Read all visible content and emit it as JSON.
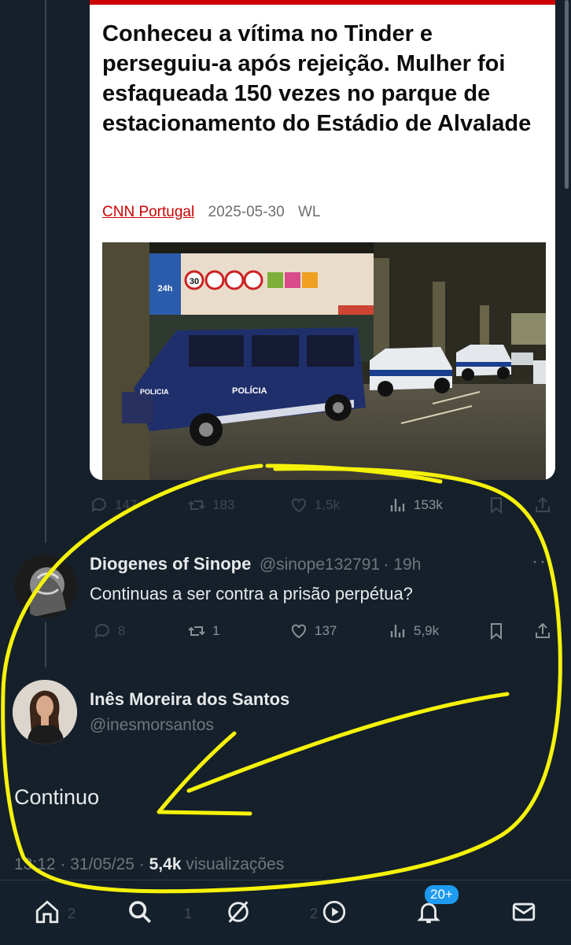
{
  "article": {
    "headline": "Conheceu a vítima no Tinder e perseguiu-a após rejeição. Mulher foi esfaqueada 150 vezes no parque de estacionamento do Estádio de Alvalade",
    "source": "CNN Portugal",
    "date": "2025-05-30",
    "author": "WL",
    "photo_text": {
      "sign_24h": "24h",
      "sign_speed": "30",
      "van_label": "POLÍCIA",
      "van_label_front": "POLICIA"
    }
  },
  "quoted_tweet_actions": {
    "replies": "147",
    "retweets": "183",
    "likes": "1,5k",
    "views": "153k"
  },
  "reply_tweet": {
    "name": "Diogenes of Sinope",
    "handle": "@sinope132791",
    "time": "· 19h",
    "text": "Continuas a ser contra a prisão perpétua?",
    "more": "··",
    "actions": {
      "replies": "8",
      "retweets": "1",
      "likes": "137",
      "views": "5,9k"
    }
  },
  "main_tweet": {
    "name": "Inês Moreira dos Santos",
    "handle": "@inesmorsantos",
    "text": "Continuo",
    "time": "13:12 · 31/05/25 · ",
    "views_count": "5,4k",
    "views_label": " visualizações"
  },
  "ghost_actions": {
    "replies": "2",
    "retweets": "1",
    "likes": "2"
  },
  "bottom_nav": {
    "notifications_badge": "20+"
  },
  "colors": {
    "background": "#15202b",
    "text": "#e7e9ea",
    "muted": "#71767b",
    "accent": "#1d9bf0",
    "cnn_red": "#cc0000",
    "highlight": "#f5f20a"
  }
}
